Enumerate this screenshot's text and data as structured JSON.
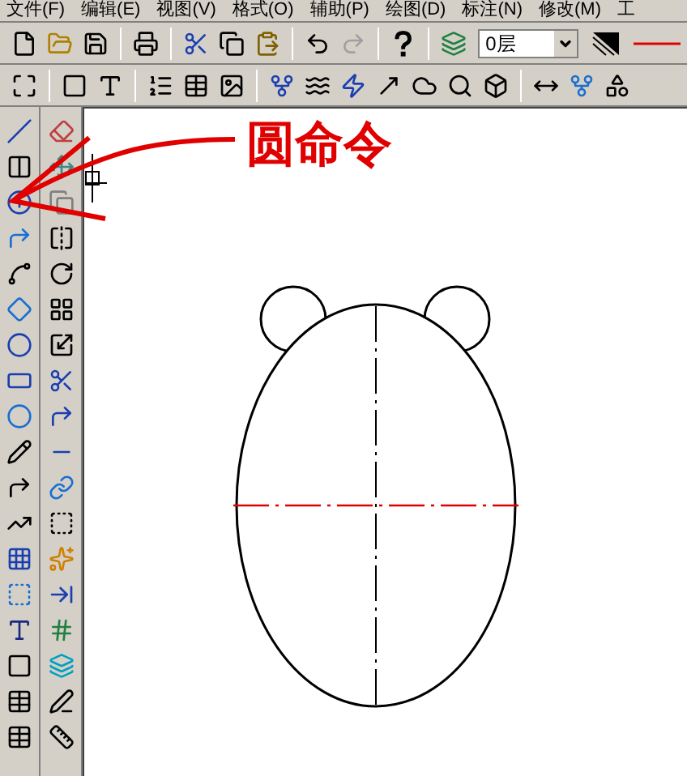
{
  "menu_bar": [
    "文件(F)",
    "编辑(E)",
    "视图(V)",
    "格式(O)",
    "辅助(P)",
    "绘图(D)",
    "标注(N)",
    "修改(M)",
    "工"
  ],
  "standard_toolbar": {
    "redo_disabled": true
  },
  "layer_select": {
    "value": "0层"
  },
  "annotation": {
    "text": "圆命令"
  }
}
